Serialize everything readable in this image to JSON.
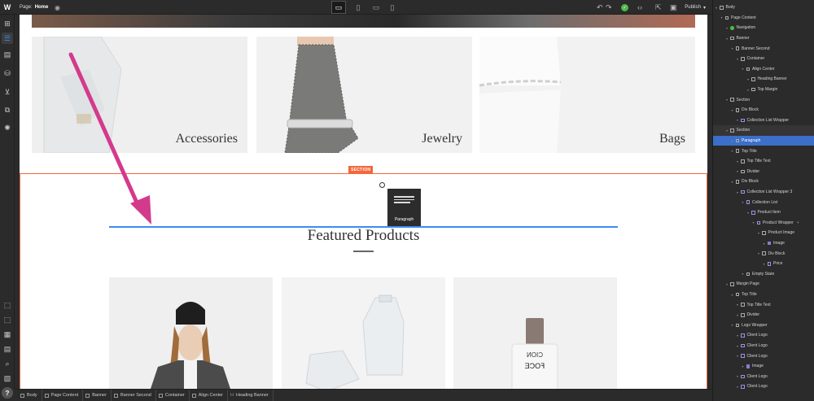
{
  "topbar": {
    "logo": "W",
    "page_prefix": "Page:",
    "page_name": "Home",
    "publish_label": "Publish",
    "devices": [
      "desktop-icon",
      "tablet-icon",
      "mobile-landscape-icon",
      "mobile-portrait-icon"
    ]
  },
  "left_toolbar": {
    "top": [
      "add-icon",
      "navigator-icon",
      "pages-icon",
      "cms-icon",
      "ecommerce-icon",
      "symbols-icon",
      "settings-icon"
    ],
    "bottom": [
      "select-icon",
      "xray-icon",
      "grid-icon",
      "audit-icon",
      "search-icon",
      "assets-icon",
      "help-icon"
    ]
  },
  "canvas": {
    "categories": [
      {
        "label": "Accessories"
      },
      {
        "label": "Jewelry"
      },
      {
        "label": "Bags"
      }
    ],
    "section_tag": "SECTION",
    "drag_item_label": "Paragraph",
    "featured_heading": "Featured Products"
  },
  "breadcrumb": [
    "Body",
    "Page Content",
    "Banner",
    "Banner Second",
    "Container",
    "Align Center",
    "Heading Banner"
  ],
  "navigator": {
    "items": [
      {
        "label": "Body",
        "depth": 0,
        "icon": "box"
      },
      {
        "label": "Page Content",
        "depth": 1,
        "icon": "box"
      },
      {
        "label": "Navigation",
        "depth": 2,
        "icon": "dot"
      },
      {
        "label": "Banner",
        "depth": 2,
        "icon": "box"
      },
      {
        "label": "Banner Second",
        "depth": 3,
        "icon": "box"
      },
      {
        "label": "Container",
        "depth": 4,
        "icon": "box"
      },
      {
        "label": "Align Center",
        "depth": 5,
        "icon": "box"
      },
      {
        "label": "Heading Banner",
        "depth": 6,
        "icon": "box"
      },
      {
        "label": "Top Margin",
        "depth": 6,
        "icon": "box"
      },
      {
        "label": "Section",
        "depth": 2,
        "icon": "box"
      },
      {
        "label": "Div Block",
        "depth": 3,
        "icon": "box"
      },
      {
        "label": "Collection List Wrapper",
        "depth": 4,
        "icon": "col"
      },
      {
        "label": "Section",
        "depth": 2,
        "icon": "box",
        "state": "hl"
      },
      {
        "label": "Paragraph",
        "depth": 3,
        "icon": "box",
        "state": "selected"
      },
      {
        "label": "Top Title",
        "depth": 3,
        "icon": "box"
      },
      {
        "label": "Top Title Text",
        "depth": 4,
        "icon": "box"
      },
      {
        "label": "Divider",
        "depth": 4,
        "icon": "box"
      },
      {
        "label": "Div Block",
        "depth": 3,
        "icon": "box"
      },
      {
        "label": "Collection List Wrapper 3",
        "depth": 4,
        "icon": "col"
      },
      {
        "label": "Collection List",
        "depth": 5,
        "icon": "col"
      },
      {
        "label": "Product Item",
        "depth": 6,
        "icon": "col"
      },
      {
        "label": "Product Wrapper",
        "depth": 7,
        "icon": "col",
        "add": "+"
      },
      {
        "label": "Product Image",
        "depth": 8,
        "icon": "box"
      },
      {
        "label": "Image",
        "depth": 9,
        "icon": "img"
      },
      {
        "label": "Div Block",
        "depth": 8,
        "icon": "box"
      },
      {
        "label": "Price",
        "depth": 9,
        "icon": "col"
      },
      {
        "label": "Empty State",
        "depth": 5,
        "icon": "box"
      },
      {
        "label": "Margin Page",
        "depth": 2,
        "icon": "box"
      },
      {
        "label": "Top Title",
        "depth": 3,
        "icon": "box"
      },
      {
        "label": "Top Title Text",
        "depth": 4,
        "icon": "box"
      },
      {
        "label": "Divider",
        "depth": 4,
        "icon": "box"
      },
      {
        "label": "Logo Wrapper",
        "depth": 3,
        "icon": "box"
      },
      {
        "label": "Client Logo",
        "depth": 4,
        "icon": "col"
      },
      {
        "label": "Client Logo",
        "depth": 4,
        "icon": "col"
      },
      {
        "label": "Client Logo",
        "depth": 4,
        "icon": "col"
      },
      {
        "label": "Image",
        "depth": 5,
        "icon": "img"
      },
      {
        "label": "Client Logo",
        "depth": 4,
        "icon": "col"
      },
      {
        "label": "Client Logo",
        "depth": 4,
        "icon": "col"
      }
    ]
  },
  "colors": {
    "accent": "#3b6fc9",
    "section_outline": "#f4673a",
    "drop_indicator": "#3d8bf2",
    "annotation_arrow": "#d43a8c",
    "publish_ok": "#4cb944"
  }
}
